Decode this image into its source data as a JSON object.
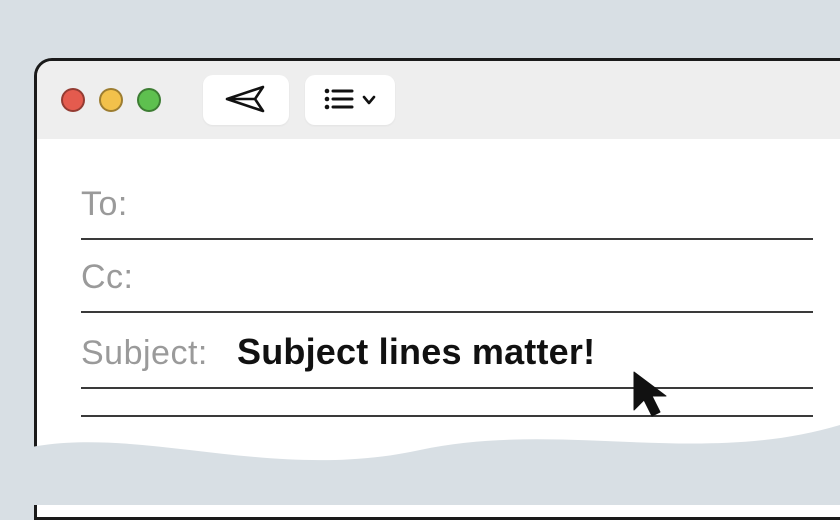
{
  "window": {
    "traffic_lights": {
      "close": "close-icon",
      "minimize": "minimize-icon",
      "zoom": "zoom-icon"
    }
  },
  "toolbar": {
    "send_icon": "paper-plane-icon",
    "list_icon": "list-icon",
    "chevron_icon": "chevron-down-icon"
  },
  "compose": {
    "to": {
      "label": "To:",
      "value": ""
    },
    "cc": {
      "label": "Cc:",
      "value": ""
    },
    "subject": {
      "label": "Subject:",
      "value": "Subject lines matter!"
    }
  },
  "cursor_icon": "cursor-arrow-icon"
}
